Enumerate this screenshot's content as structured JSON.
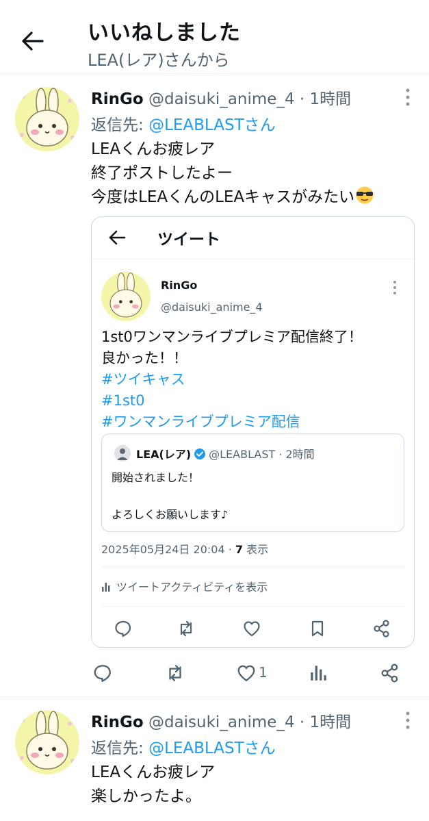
{
  "header": {
    "title": "いいねしました",
    "subtitle": "LEA(レア)さんから"
  },
  "colors": {
    "accent": "#1d9bf0",
    "text": "#0f1419",
    "muted": "#536471",
    "border": "#cfd9de"
  },
  "tweets": [
    {
      "name": "RinGo",
      "handle": "@daisuki_anime_4",
      "time": "· 1時間",
      "reply_prefix": "返信先: ",
      "reply_to": "@LEABLASTさん",
      "lines": [
        "LEAくんお疲レア",
        "終了ポストしたよー",
        "今度はLEAくんのLEAキャスがみたい"
      ],
      "emoji": "sunglasses-emoji",
      "like_count": "1"
    },
    {
      "name": "RinGo",
      "handle": "@daisuki_anime_4",
      "time": "· 1時間",
      "reply_prefix": "返信先: ",
      "reply_to": "@LEABLASTさん",
      "lines": [
        "LEAくんお疲レア",
        "楽しかったよ。"
      ]
    }
  ],
  "embedded": {
    "header_title": "ツイート",
    "name": "RinGo",
    "handle": "@daisuki_anime_4",
    "text_lines": [
      "1st0ワンマンライブプレミア配信終了！",
      "良かった！！"
    ],
    "hashtags": [
      "#ツイキャス",
      "#1st0",
      "#ワンマンライブプレミア配信"
    ],
    "quote": {
      "name": "LEA(レア)",
      "handle": "@LEABLAST · 2時間",
      "line1": "開始されました！",
      "line2": "よろしくお願いします♪"
    },
    "date": "2025年05月24日 20:04 · ",
    "views_count": "7",
    "views_label": " 表示",
    "activity_label": "ツイートアクティビティを表示"
  }
}
